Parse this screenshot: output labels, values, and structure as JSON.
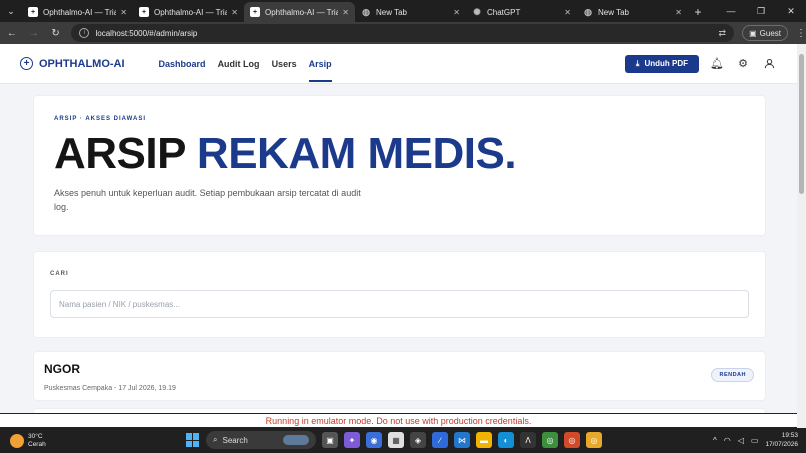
{
  "browser": {
    "tabs": [
      {
        "title": "Ophthalmo-AI — Triase Ke",
        "icon": "plus-favicon",
        "active": false
      },
      {
        "title": "Ophthalmo-AI — Triase Ke",
        "icon": "plus-favicon",
        "active": false
      },
      {
        "title": "Ophthalmo-AI — Triase Ke",
        "icon": "plus-favicon",
        "active": true
      },
      {
        "title": "New Tab",
        "icon": "globe-icon",
        "active": false
      },
      {
        "title": "ChatGPT",
        "icon": "chatgpt-icon",
        "active": false
      },
      {
        "title": "New Tab",
        "icon": "globe-icon",
        "active": false
      }
    ],
    "url": "localhost:5000/#/admin/arsip",
    "profile_label": "Guest"
  },
  "app": {
    "brand": "OPHTHALMO-AI",
    "nav": [
      "Dashboard",
      "Audit Log",
      "Users",
      "Arsip"
    ],
    "active_nav": "Arsip",
    "pdf_button": "Unduh PDF"
  },
  "hero": {
    "kicker": "ARSIP · AKSES DIAWASI",
    "title_part1": "ARSIP",
    "title_part2": "REKAM MEDIS.",
    "description": "Akses penuh untuk keperluan audit. Setiap pembukaan arsip tercatat di audit log."
  },
  "search": {
    "label": "CARI",
    "placeholder": "Nama pasien / NIK / puskesmas..."
  },
  "records": [
    {
      "name": "NGOR",
      "meta": "Puskesmas Cempaka - 17 Jul 2026, 19.19",
      "badge": "RENDAH"
    }
  ],
  "emulator_banner": "Running in emulator mode. Do not use with production credentials.",
  "taskbar": {
    "weather_temp": "30°C",
    "weather_desc": "Cerah",
    "search_label": "Search",
    "time": "19:53",
    "date": "17/07/2026"
  },
  "colors": {
    "brand": "#1c3a8c",
    "banner_text": "#c0392b"
  }
}
